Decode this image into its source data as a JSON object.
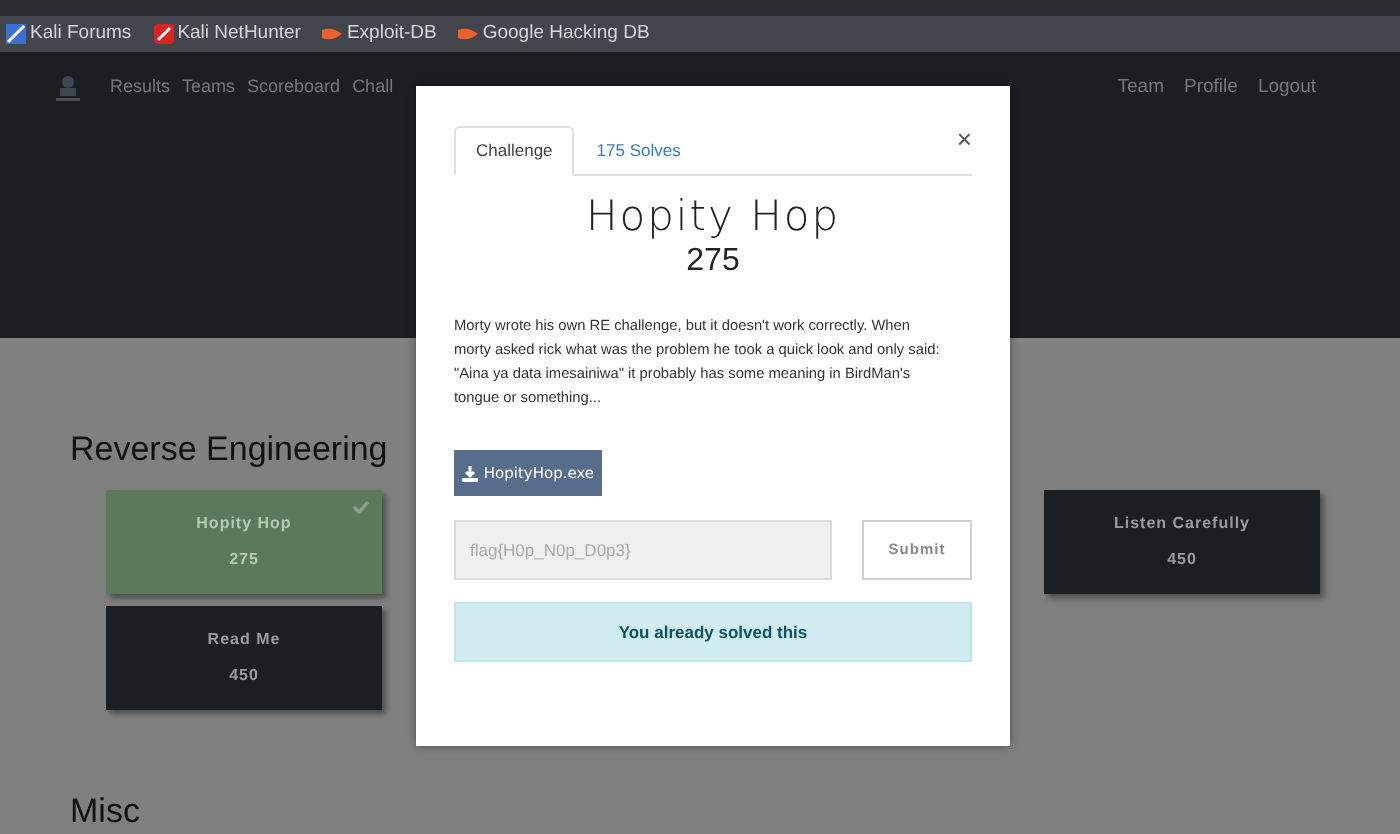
{
  "bookmarks": [
    {
      "label": "Kali Forums",
      "kind": "kali"
    },
    {
      "label": "Kali NetHunter",
      "kind": "nethunter"
    },
    {
      "label": "Exploit-DB",
      "kind": "exploit"
    },
    {
      "label": "Google Hacking DB",
      "kind": "exploit"
    }
  ],
  "nav": {
    "left": [
      "Results",
      "Teams",
      "Scoreboard",
      "Chall"
    ],
    "right": [
      "Team",
      "Profile",
      "Logout"
    ]
  },
  "categories": [
    {
      "title": "Reverse Engineering",
      "challenges": [
        {
          "name": "Hopity Hop",
          "value": "275",
          "solved": true
        },
        {
          "name": "Read Me",
          "value": "450",
          "solved": false
        }
      ],
      "right_challenges": [
        {
          "name": "Listen Carefully",
          "value": "450",
          "solved": false
        }
      ]
    },
    {
      "title": "Misc"
    }
  ],
  "modal": {
    "tabs": [
      {
        "label": "Challenge",
        "selected": true
      },
      {
        "label": "175 Solves",
        "selected": false
      }
    ],
    "close": "×",
    "title": "Hopity Hop",
    "value": "275",
    "description": "Morty wrote his own RE challenge, but it doesn't work correctly. When morty asked rick what was the problem he took a quick look and only said: \"Aina ya data imesainiwa\" it probably has some meaning in BirdMan's tongue or something...",
    "file": "HopityHop.exe",
    "flag_value": "flag{H0p_N0p_D0p3}",
    "submit": "Submit",
    "alert": "You already solved this"
  }
}
